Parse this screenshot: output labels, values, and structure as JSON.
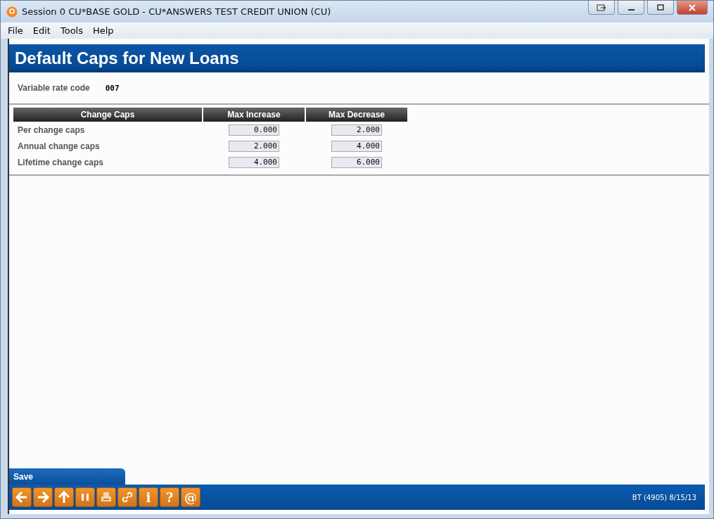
{
  "window": {
    "title": "Session 0 CU*BASE GOLD - CU*ANSWERS TEST CREDIT UNION (CU)"
  },
  "menu": [
    "File",
    "Edit",
    "Tools",
    "Help"
  ],
  "page_title": "Default Caps for New Loans",
  "rate_code": {
    "label": "Variable rate code",
    "value": "007"
  },
  "table": {
    "columns": [
      "Change Caps",
      "Max Increase",
      "Max Decrease"
    ],
    "rows": [
      {
        "label": "Per change caps",
        "values": [
          "0.000",
          "2.000"
        ]
      },
      {
        "label": "Annual change caps",
        "values": [
          "2.000",
          "4.000"
        ]
      },
      {
        "label": "Lifetime change caps",
        "values": [
          "4.000",
          "6.000"
        ]
      }
    ]
  },
  "save_tab": "Save",
  "toolbar": [
    {
      "kind": "back"
    },
    {
      "kind": "forward"
    },
    {
      "kind": "up"
    },
    {
      "kind": "pause"
    },
    {
      "kind": "print"
    },
    {
      "kind": "link"
    },
    {
      "kind": "glyph",
      "glyph": "i"
    },
    {
      "kind": "glyph",
      "glyph": "?"
    },
    {
      "kind": "glyph",
      "glyph": "@"
    }
  ],
  "status": "BT (4905) 8/15/13"
}
